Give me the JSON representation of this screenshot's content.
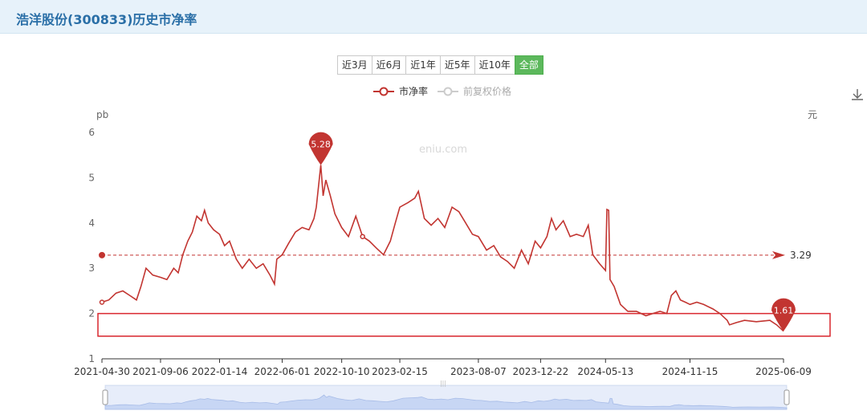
{
  "header": {
    "title": "浩洋股份(300833)历史市净率"
  },
  "range_buttons": [
    {
      "label": "近3月",
      "active": false
    },
    {
      "label": "近6月",
      "active": false
    },
    {
      "label": "近1年",
      "active": false
    },
    {
      "label": "近5年",
      "active": false
    },
    {
      "label": "近10年",
      "active": false
    },
    {
      "label": "全部",
      "active": true
    }
  ],
  "colors": {
    "series": "#c23531",
    "inactive_series": "#cccccc",
    "accent_green": "#5cb85c",
    "header_bg": "#e7f2fa",
    "header_text": "#2a6fa7",
    "highlight_box": "#d9262d",
    "slider_fill": "#d5e0f7"
  },
  "icons": {
    "download": "download-icon"
  },
  "chart_data": {
    "type": "line",
    "watermark": "eniu.com",
    "legend": [
      {
        "name": "市净率",
        "active": true
      },
      {
        "name": "前复权价格",
        "active": false
      }
    ],
    "legend_position": "top-center",
    "y_left": {
      "unit": "pb",
      "ticks": [
        1,
        2,
        3,
        4,
        5,
        6
      ],
      "range": [
        1,
        6
      ]
    },
    "y_right": {
      "unit": "元"
    },
    "x_ticks": [
      "2021-04-30",
      "2021-09-06",
      "2022-01-14",
      "2022-06-01",
      "2022-10-10",
      "2023-02-15",
      "2023-08-07",
      "2023-12-22",
      "2024-05-13",
      "2024-11-15",
      "2025-06-09"
    ],
    "x_range": [
      "2021-04-30",
      "2025-06-09"
    ],
    "grid": false,
    "series": [
      {
        "name": "市净率",
        "points": [
          [
            "2021-04-30",
            2.25
          ],
          [
            "2021-05-15",
            2.3
          ],
          [
            "2021-05-31",
            2.45
          ],
          [
            "2021-06-15",
            2.5
          ],
          [
            "2021-06-30",
            2.4
          ],
          [
            "2021-07-15",
            2.3
          ],
          [
            "2021-07-25",
            2.6
          ],
          [
            "2021-08-05",
            3.0
          ],
          [
            "2021-08-20",
            2.85
          ],
          [
            "2021-09-06",
            2.8
          ],
          [
            "2021-09-20",
            2.75
          ],
          [
            "2021-10-05",
            3.0
          ],
          [
            "2021-10-15",
            2.9
          ],
          [
            "2021-10-25",
            3.3
          ],
          [
            "2021-11-05",
            3.6
          ],
          [
            "2021-11-15",
            3.8
          ],
          [
            "2021-11-25",
            4.15
          ],
          [
            "2021-12-05",
            4.05
          ],
          [
            "2021-12-12",
            4.28
          ],
          [
            "2021-12-20",
            4.0
          ],
          [
            "2022-01-01",
            3.85
          ],
          [
            "2022-01-14",
            3.75
          ],
          [
            "2022-01-25",
            3.5
          ],
          [
            "2022-02-05",
            3.6
          ],
          [
            "2022-02-20",
            3.2
          ],
          [
            "2022-03-05",
            3.0
          ],
          [
            "2022-03-20",
            3.2
          ],
          [
            "2022-04-05",
            3.0
          ],
          [
            "2022-04-20",
            3.1
          ],
          [
            "2022-05-05",
            2.85
          ],
          [
            "2022-05-15",
            2.65
          ],
          [
            "2022-05-20",
            3.2
          ],
          [
            "2022-06-01",
            3.3
          ],
          [
            "2022-06-15",
            3.55
          ],
          [
            "2022-06-30",
            3.8
          ],
          [
            "2022-07-15",
            3.9
          ],
          [
            "2022-07-30",
            3.85
          ],
          [
            "2022-08-10",
            4.1
          ],
          [
            "2022-08-15",
            4.35
          ],
          [
            "2022-08-25",
            5.28
          ],
          [
            "2022-08-30",
            4.6
          ],
          [
            "2022-09-05",
            4.95
          ],
          [
            "2022-09-15",
            4.6
          ],
          [
            "2022-09-25",
            4.2
          ],
          [
            "2022-10-10",
            3.9
          ],
          [
            "2022-10-25",
            3.7
          ],
          [
            "2022-11-10",
            4.15
          ],
          [
            "2022-11-25",
            3.7
          ],
          [
            "2022-12-10",
            3.6
          ],
          [
            "2022-12-25",
            3.45
          ],
          [
            "2023-01-10",
            3.3
          ],
          [
            "2023-01-25",
            3.6
          ],
          [
            "2023-02-05",
            4.0
          ],
          [
            "2023-02-15",
            4.35
          ],
          [
            "2023-03-05",
            4.45
          ],
          [
            "2023-03-20",
            4.55
          ],
          [
            "2023-03-28",
            4.7
          ],
          [
            "2023-04-10",
            4.1
          ],
          [
            "2023-04-25",
            3.95
          ],
          [
            "2023-05-10",
            4.1
          ],
          [
            "2023-05-25",
            3.9
          ],
          [
            "2023-06-10",
            4.35
          ],
          [
            "2023-06-25",
            4.25
          ],
          [
            "2023-07-10",
            4.0
          ],
          [
            "2023-07-25",
            3.75
          ],
          [
            "2023-08-07",
            3.7
          ],
          [
            "2023-08-25",
            3.4
          ],
          [
            "2023-09-10",
            3.5
          ],
          [
            "2023-09-25",
            3.25
          ],
          [
            "2023-10-10",
            3.15
          ],
          [
            "2023-10-25",
            3.0
          ],
          [
            "2023-11-10",
            3.4
          ],
          [
            "2023-11-25",
            3.1
          ],
          [
            "2023-12-10",
            3.6
          ],
          [
            "2023-12-22",
            3.45
          ],
          [
            "2024-01-05",
            3.7
          ],
          [
            "2024-01-15",
            4.1
          ],
          [
            "2024-01-25",
            3.85
          ],
          [
            "2024-02-10",
            4.05
          ],
          [
            "2024-02-25",
            3.7
          ],
          [
            "2024-03-10",
            3.75
          ],
          [
            "2024-03-25",
            3.7
          ],
          [
            "2024-04-05",
            3.95
          ],
          [
            "2024-04-15",
            3.3
          ],
          [
            "2024-04-30",
            3.1
          ],
          [
            "2024-05-13",
            2.95
          ],
          [
            "2024-05-16",
            4.3
          ],
          [
            "2024-05-20",
            4.28
          ],
          [
            "2024-05-23",
            2.75
          ],
          [
            "2024-06-01",
            2.6
          ],
          [
            "2024-06-15",
            2.2
          ],
          [
            "2024-07-01",
            2.05
          ],
          [
            "2024-07-20",
            2.05
          ],
          [
            "2024-08-10",
            1.95
          ],
          [
            "2024-08-25",
            2.0
          ],
          [
            "2024-09-10",
            2.05
          ],
          [
            "2024-09-25",
            2.0
          ],
          [
            "2024-10-05",
            2.4
          ],
          [
            "2024-10-15",
            2.5
          ],
          [
            "2024-10-25",
            2.3
          ],
          [
            "2024-11-05",
            2.25
          ],
          [
            "2024-11-15",
            2.2
          ],
          [
            "2024-11-30",
            2.25
          ],
          [
            "2024-12-15",
            2.2
          ],
          [
            "2025-01-05",
            2.1
          ],
          [
            "2025-01-20",
            2.0
          ],
          [
            "2025-02-05",
            1.85
          ],
          [
            "2025-02-10",
            1.75
          ],
          [
            "2025-02-25",
            1.8
          ],
          [
            "2025-03-15",
            1.85
          ],
          [
            "2025-04-10",
            1.82
          ],
          [
            "2025-05-10",
            1.85
          ],
          [
            "2025-05-25",
            1.75
          ],
          [
            "2025-06-09",
            1.61
          ]
        ]
      }
    ],
    "annotations": {
      "max_marker": {
        "date": "2022-08-25",
        "value": 5.28,
        "label": "5.28"
      },
      "last_marker": {
        "date": "2025-06-09",
        "value": 1.61,
        "label": "1.61"
      },
      "mean_line": {
        "value": 3.29,
        "label": "3.29"
      },
      "highlight_box": {
        "x_range": [
          "2021-04-30",
          "2025-06-09"
        ],
        "y_range": [
          1.5,
          2.0
        ]
      }
    },
    "slider": {
      "window": [
        "2021-04-30",
        "2025-06-09"
      ],
      "handle_label": "|||"
    }
  }
}
